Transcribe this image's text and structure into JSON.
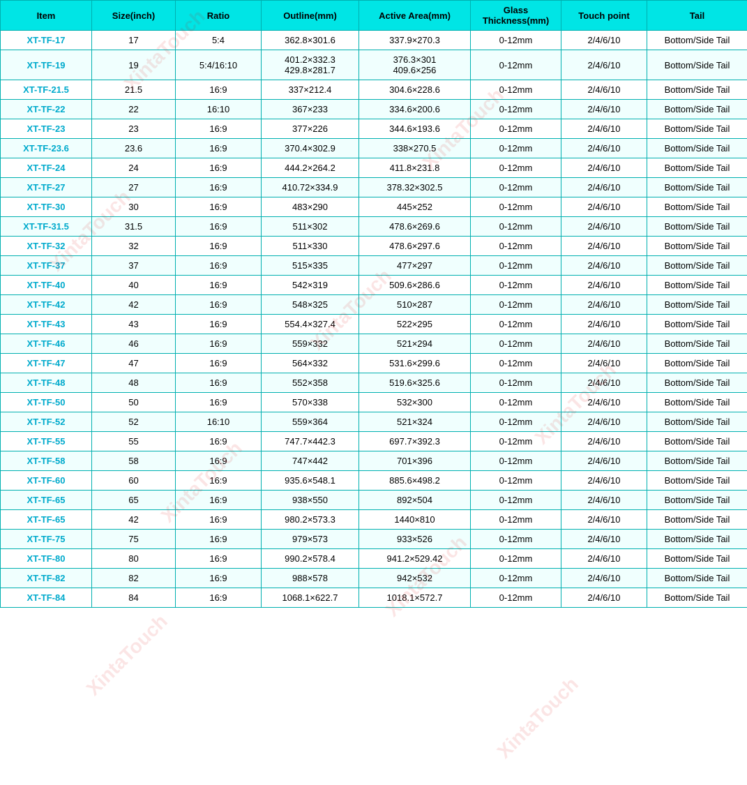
{
  "table": {
    "headers": [
      "Item",
      "Size(inch)",
      "Ratio",
      "Outline(mm)",
      "Active Area(mm)",
      "Glass\nThickness(mm)",
      "Touch point",
      "Tail"
    ],
    "rows": [
      [
        "XT-TF-17",
        "17",
        "5:4",
        "362.8×301.6",
        "337.9×270.3",
        "0-12mm",
        "2/4/6/10",
        "Bottom/Side Tail"
      ],
      [
        "XT-TF-19",
        "19",
        "5:4/16:10",
        "401.2×332.3\n429.8×281.7",
        "376.3×301\n409.6×256",
        "0-12mm",
        "2/4/6/10",
        "Bottom/Side Tail"
      ],
      [
        "XT-TF-21.5",
        "21.5",
        "16:9",
        "337×212.4",
        "304.6×228.6",
        "0-12mm",
        "2/4/6/10",
        "Bottom/Side Tail"
      ],
      [
        "XT-TF-22",
        "22",
        "16:10",
        "367×233",
        "334.6×200.6",
        "0-12mm",
        "2/4/6/10",
        "Bottom/Side Tail"
      ],
      [
        "XT-TF-23",
        "23",
        "16:9",
        "377×226",
        "344.6×193.6",
        "0-12mm",
        "2/4/6/10",
        "Bottom/Side Tail"
      ],
      [
        "XT-TF-23.6",
        "23.6",
        "16:9",
        "370.4×302.9",
        "338×270.5",
        "0-12mm",
        "2/4/6/10",
        "Bottom/Side Tail"
      ],
      [
        "XT-TF-24",
        "24",
        "16:9",
        "444.2×264.2",
        "411.8×231.8",
        "0-12mm",
        "2/4/6/10",
        "Bottom/Side Tail"
      ],
      [
        "XT-TF-27",
        "27",
        "16:9",
        "410.72×334.9",
        "378.32×302.5",
        "0-12mm",
        "2/4/6/10",
        "Bottom/Side Tail"
      ],
      [
        "XT-TF-30",
        "30",
        "16:9",
        "483×290",
        "445×252",
        "0-12mm",
        "2/4/6/10",
        "Bottom/Side Tail"
      ],
      [
        "XT-TF-31.5",
        "31.5",
        "16:9",
        "511×302",
        "478.6×269.6",
        "0-12mm",
        "2/4/6/10",
        "Bottom/Side Tail"
      ],
      [
        "XT-TF-32",
        "32",
        "16:9",
        "511×330",
        "478.6×297.6",
        "0-12mm",
        "2/4/6/10",
        "Bottom/Side Tail"
      ],
      [
        "XT-TF-37",
        "37",
        "16:9",
        "515×335",
        "477×297",
        "0-12mm",
        "2/4/6/10",
        "Bottom/Side Tail"
      ],
      [
        "XT-TF-40",
        "40",
        "16:9",
        "542×319",
        "509.6×286.6",
        "0-12mm",
        "2/4/6/10",
        "Bottom/Side Tail"
      ],
      [
        "XT-TF-42",
        "42",
        "16:9",
        "548×325",
        "510×287",
        "0-12mm",
        "2/4/6/10",
        "Bottom/Side Tail"
      ],
      [
        "XT-TF-43",
        "43",
        "16:9",
        "554.4×327.4",
        "522×295",
        "0-12mm",
        "2/4/6/10",
        "Bottom/Side Tail"
      ],
      [
        "XT-TF-46",
        "46",
        "16:9",
        "559×332",
        "521×294",
        "0-12mm",
        "2/4/6/10",
        "Bottom/Side Tail"
      ],
      [
        "XT-TF-47",
        "47",
        "16:9",
        "564×332",
        "531.6×299.6",
        "0-12mm",
        "2/4/6/10",
        "Bottom/Side Tail"
      ],
      [
        "XT-TF-48",
        "48",
        "16:9",
        "552×358",
        "519.6×325.6",
        "0-12mm",
        "2/4/6/10",
        "Bottom/Side Tail"
      ],
      [
        "XT-TF-50",
        "50",
        "16:9",
        "570×338",
        "532×300",
        "0-12mm",
        "2/4/6/10",
        "Bottom/Side Tail"
      ],
      [
        "XT-TF-52",
        "52",
        "16:10",
        "559×364",
        "521×324",
        "0-12mm",
        "2/4/6/10",
        "Bottom/Side Tail"
      ],
      [
        "XT-TF-55",
        "55",
        "16:9",
        "747.7×442.3",
        "697.7×392.3",
        "0-12mm",
        "2/4/6/10",
        "Bottom/Side Tail"
      ],
      [
        "XT-TF-58",
        "58",
        "16:9",
        "747×442",
        "701×396",
        "0-12mm",
        "2/4/6/10",
        "Bottom/Side Tail"
      ],
      [
        "XT-TF-60",
        "60",
        "16:9",
        "935.6×548.1",
        "885.6×498.2",
        "0-12mm",
        "2/4/6/10",
        "Bottom/Side Tail"
      ],
      [
        "XT-TF-65",
        "65",
        "16:9",
        "938×550",
        "892×504",
        "0-12mm",
        "2/4/6/10",
        "Bottom/Side Tail"
      ],
      [
        "XT-TF-65",
        "42",
        "16:9",
        "980.2×573.3",
        "1440×810",
        "0-12mm",
        "2/4/6/10",
        "Bottom/Side Tail"
      ],
      [
        "XT-TF-75",
        "75",
        "16:9",
        "979×573",
        "933×526",
        "0-12mm",
        "2/4/6/10",
        "Bottom/Side Tail"
      ],
      [
        "XT-TF-80",
        "80",
        "16:9",
        "990.2×578.4",
        "941.2×529.42",
        "0-12mm",
        "2/4/6/10",
        "Bottom/Side Tail"
      ],
      [
        "XT-TF-82",
        "82",
        "16:9",
        "988×578",
        "942×532",
        "0-12mm",
        "2/4/6/10",
        "Bottom/Side Tail"
      ],
      [
        "XT-TF-84",
        "84",
        "16:9",
        "1068.1×622.7",
        "1018.1×572.7",
        "0-12mm",
        "2/4/6/10",
        "Bottom/Side Tail"
      ]
    ]
  }
}
